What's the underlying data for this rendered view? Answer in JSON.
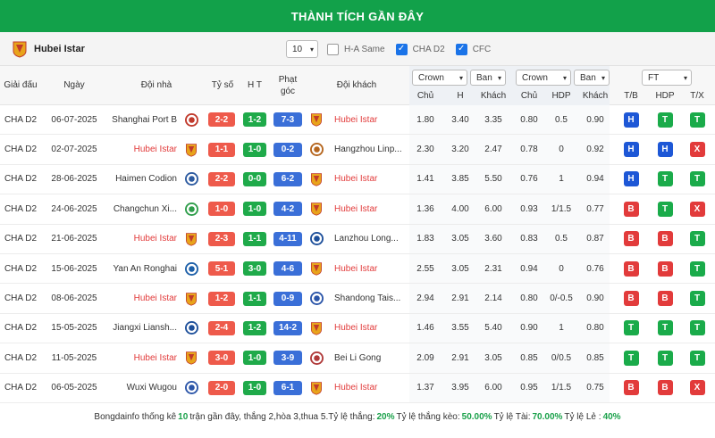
{
  "title": "THÀNH TÍCH GẦN ĐÂY",
  "team": {
    "name": "Hubei Istar",
    "logo": "hubei-istar-crest-icon"
  },
  "filters": {
    "count": "10",
    "options": [
      {
        "label": "H-A Same",
        "checked": false
      },
      {
        "label": "CHA D2",
        "checked": true
      },
      {
        "label": "CFC",
        "checked": true
      }
    ]
  },
  "headers": {
    "league": "Giải đấu",
    "date": "Ngày",
    "home": "Đội nhà",
    "score": "Tỷ số",
    "ht": "H T",
    "corner": "Phạt góc",
    "away": "Đội khách",
    "odds_select_1": "Crown",
    "odds_select_2": "Ban",
    "odds_select_3": "Crown",
    "odds_select_4": "Ban",
    "ft_select": "FT",
    "o1": "Chủ",
    "o2": "H",
    "o3": "Khách",
    "o4": "Chủ",
    "o5": "HDP",
    "o6": "Khách",
    "r1": "T/B",
    "r2": "HDP",
    "r3": "T/X"
  },
  "rows": [
    {
      "league": "CHA D2",
      "date": "06-07-2025",
      "home": "Shanghai Port B",
      "home_istar": false,
      "score": "2-2",
      "ht": "1-2",
      "corner": "7-3",
      "away": "Hubei Istar",
      "away_istar": true,
      "o1": "1.80",
      "o2": "3.40",
      "o3": "3.35",
      "o4": "0.80",
      "o5": "0.5",
      "o6": "0.90",
      "r1": "H",
      "r2": "T",
      "r3": "T"
    },
    {
      "league": "CHA D2",
      "date": "02-07-2025",
      "home": "Hubei Istar",
      "home_istar": true,
      "score": "1-1",
      "ht": "1-0",
      "corner": "0-2",
      "away": "Hangzhou Linp...",
      "away_istar": false,
      "o1": "2.30",
      "o2": "3.20",
      "o3": "2.47",
      "o4": "0.78",
      "o5": "0",
      "o6": "0.92",
      "r1": "H",
      "r2": "H",
      "r3": "X"
    },
    {
      "league": "CHA D2",
      "date": "28-06-2025",
      "home": "Haimen Codion",
      "home_istar": false,
      "score": "2-2",
      "ht": "0-0",
      "corner": "6-2",
      "away": "Hubei Istar",
      "away_istar": true,
      "o1": "1.41",
      "o2": "3.85",
      "o3": "5.50",
      "o4": "0.76",
      "o5": "1",
      "o6": "0.94",
      "r1": "H",
      "r2": "T",
      "r3": "T"
    },
    {
      "league": "CHA D2",
      "date": "24-06-2025",
      "home": "Changchun Xi...",
      "home_istar": false,
      "score": "1-0",
      "ht": "1-0",
      "corner": "4-2",
      "away": "Hubei Istar",
      "away_istar": true,
      "o1": "1.36",
      "o2": "4.00",
      "o3": "6.00",
      "o4": "0.93",
      "o5": "1/1.5",
      "o6": "0.77",
      "r1": "B",
      "r2": "T",
      "r3": "X"
    },
    {
      "league": "CHA D2",
      "date": "21-06-2025",
      "home": "Hubei Istar",
      "home_istar": true,
      "score": "2-3",
      "ht": "1-1",
      "corner": "4-11",
      "away": "Lanzhou Long...",
      "away_istar": false,
      "o1": "1.83",
      "o2": "3.05",
      "o3": "3.60",
      "o4": "0.83",
      "o5": "0.5",
      "o6": "0.87",
      "r1": "B",
      "r2": "B",
      "r3": "T"
    },
    {
      "league": "CHA D2",
      "date": "15-06-2025",
      "home": "Yan An Ronghai",
      "home_istar": false,
      "score": "5-1",
      "ht": "3-0",
      "corner": "4-6",
      "away": "Hubei Istar",
      "away_istar": true,
      "o1": "2.55",
      "o2": "3.05",
      "o3": "2.31",
      "o4": "0.94",
      "o5": "0",
      "o6": "0.76",
      "r1": "B",
      "r2": "B",
      "r3": "T"
    },
    {
      "league": "CHA D2",
      "date": "08-06-2025",
      "home": "Hubei Istar",
      "home_istar": true,
      "score": "1-2",
      "ht": "1-1",
      "corner": "0-9",
      "away": "Shandong Tais...",
      "away_istar": false,
      "o1": "2.94",
      "o2": "2.91",
      "o3": "2.14",
      "o4": "0.80",
      "o5": "0/-0.5",
      "o6": "0.90",
      "r1": "B",
      "r2": "B",
      "r3": "T"
    },
    {
      "league": "CHA D2",
      "date": "15-05-2025",
      "home": "Jiangxi Liansh...",
      "home_istar": false,
      "score": "2-4",
      "ht": "1-2",
      "corner": "14-2",
      "away": "Hubei Istar",
      "away_istar": true,
      "o1": "1.46",
      "o2": "3.55",
      "o3": "5.40",
      "o4": "0.90",
      "o5": "1",
      "o6": "0.80",
      "r1": "T",
      "r2": "T",
      "r3": "T"
    },
    {
      "league": "CHA D2",
      "date": "11-05-2025",
      "home": "Hubei Istar",
      "home_istar": true,
      "score": "3-0",
      "ht": "1-0",
      "corner": "3-9",
      "away": "Bei Li Gong",
      "away_istar": false,
      "o1": "2.09",
      "o2": "2.91",
      "o3": "3.05",
      "o4": "0.85",
      "o5": "0/0.5",
      "o6": "0.85",
      "r1": "T",
      "r2": "T",
      "r3": "T"
    },
    {
      "league": "CHA D2",
      "date": "06-05-2025",
      "home": "Wuxi Wugou",
      "home_istar": false,
      "score": "2-0",
      "ht": "1-0",
      "corner": "6-1",
      "away": "Hubei Istar",
      "away_istar": true,
      "o1": "1.37",
      "o2": "3.95",
      "o3": "6.00",
      "o4": "0.95",
      "o5": "1/1.5",
      "o6": "0.75",
      "r1": "B",
      "r2": "B",
      "r3": "X"
    }
  ],
  "footer": {
    "prefix": "Bongdainfo thống kê",
    "count": "10",
    "mid": "trận gần đây, thắng 2,hòa 3,thua 5.Tỷ lệ thắng:",
    "win_rate": "20%",
    "odds_label": "Tỷ lệ thắng kèo:",
    "odds_rate": "50.00%",
    "over_label": "Tỷ lệ Tài:",
    "over_rate": "70.00%",
    "odd_label": "Tỷ lệ Lẻ :",
    "odd_rate": "40%"
  },
  "colors": {
    "green": "#12a14a",
    "red": "#e23b3b",
    "blue": "#1d57d6",
    "score_bg": "#ee5a4b",
    "corner_bg": "#3a6fd8"
  }
}
